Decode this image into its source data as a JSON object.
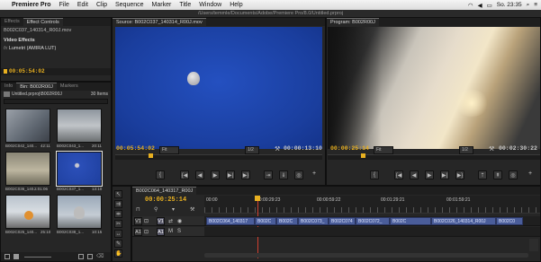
{
  "menubar": {
    "app": "Premiere Pro",
    "items": [
      "File",
      "Edit",
      "Clip",
      "Sequence",
      "Marker",
      "Title",
      "Window",
      "Help"
    ],
    "clock": "So. 23:35"
  },
  "titlebar": {
    "path": "/Users/temmle/Documents/Adobe/Premiere Pro/8.0/Untitled.prproj"
  },
  "effects_panel": {
    "tabs": [
      "Effects",
      "Effect Controls"
    ],
    "clip_name": "B002C037_140314_R00J.mov",
    "section": "Video Effects",
    "effect": "Lumetri (AMIRA LUT)",
    "fx": "fx",
    "timecode": "00:05:54:02"
  },
  "project_panel": {
    "tabs": [
      "Info",
      "Bin: B002R00J",
      "Markers"
    ],
    "path": "Untitled.prproj\\B002R00J",
    "count": "30 Items",
    "items": [
      {
        "name": "B002C042_140...",
        "dur": "42:11"
      },
      {
        "name": "B002C043_1...",
        "dur": "20:11"
      },
      {
        "name": "B002C036_140...",
        "dur": "2:01:06"
      },
      {
        "name": "B002C037_1...",
        "dur": "13:10"
      },
      {
        "name": "B002C025_140...",
        "dur": "25:10"
      },
      {
        "name": "B002C038_1...",
        "dur": "10:15"
      }
    ]
  },
  "source_monitor": {
    "tab": "Source: B002C037_140314_R00J.mov",
    "timecode_in": "00:05:54:02",
    "fit": "Fit",
    "ratio": "1/2",
    "timecode_out": "00:00:13:10"
  },
  "program_monitor": {
    "tab": "Program: B002R00J",
    "timecode_in": "00:00:25:14",
    "fit": "Fit",
    "ratio": "1/2",
    "timecode_out": "00:02:30:22"
  },
  "timeline": {
    "tab": "B002C064_140317_R00J",
    "timecode": "00:00:25:14",
    "ruler": [
      "00:00",
      "00:00:29:23",
      "00:00:59:22",
      "00:01:29:21",
      "00:01:59:21"
    ],
    "tracks": [
      {
        "target": "V1",
        "label": "V1"
      },
      {
        "target": "A1",
        "label": "A1"
      }
    ],
    "clips": [
      "B002C064_140317",
      "B002C",
      "B002C",
      "B002C073_",
      "B002C074",
      "B002C072_",
      "B002C",
      "B002C026_140314_R00J",
      "B002C0"
    ]
  },
  "colors": {
    "accent": "#e8b020",
    "clip": "#4a5d9a",
    "playhead": "#d04030"
  }
}
